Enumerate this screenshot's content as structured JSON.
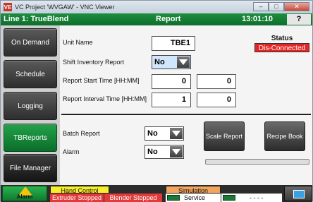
{
  "window": {
    "title": "VC Project 'WVGAW' - VNC Viewer",
    "icon": "vnc-icon",
    "min": "–",
    "max": "□",
    "close": "✕"
  },
  "header": {
    "line": "Line 1: TrueBlend",
    "screen": "Report",
    "time": "13:01:10",
    "help": "?"
  },
  "sidebar": {
    "items": [
      {
        "label": "On Demand"
      },
      {
        "label": "Schedule"
      },
      {
        "label": "Logging"
      },
      {
        "label": "TBReports"
      },
      {
        "label": "File Manager"
      }
    ]
  },
  "form": {
    "unit_name_label": "Unit Name",
    "unit_name": "TBE1",
    "shift_label": "Shift Inventory Report",
    "shift_value": "No",
    "start_label": "Report Start Time [HH:MM]",
    "start_hh": "0",
    "start_mm": "0",
    "interval_label": "Report Interval Time [HH:MM]",
    "interval_hh": "1",
    "interval_mm": "0",
    "batch_label": "Batch Report",
    "batch_value": "No",
    "alarm_label": "Alarm",
    "alarm_value": "No"
  },
  "status": {
    "title": "Status",
    "value": "Dis-Connected"
  },
  "buttons": {
    "scale": "Scale Report",
    "recipe": "Recipe Book"
  },
  "footer": {
    "alarm": "Alarm",
    "hand_control": "Hand Control",
    "extruder": "Extruder Stopped",
    "blender": "Blender Stopped",
    "simulation": "Simulation",
    "service": "Service",
    "dashes": "- - - -"
  },
  "colors": {
    "header_green": "#0f6d2c",
    "status_red": "#e32525",
    "hand_yellow": "#f5ee2b",
    "sim_orange": "#f3a45c",
    "footer_red": "#e23a3a"
  }
}
